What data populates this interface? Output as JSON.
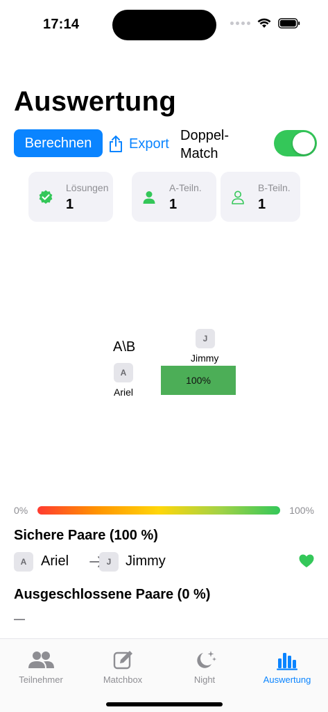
{
  "status_bar": {
    "time": "17:14"
  },
  "header": {
    "title": "Auswertung"
  },
  "toolbar": {
    "calculate_label": "Berechnen",
    "export_label": "Export",
    "double_match_line1": "Doppel-",
    "double_match_line2": "Match",
    "double_match_on": true
  },
  "stats": [
    {
      "label": "Lösungen",
      "value": "1",
      "icon": "checkmark-seal-icon"
    },
    {
      "label": "A-Teiln.",
      "value": "1",
      "icon": "person-fill-icon"
    },
    {
      "label": "B-Teiln.",
      "value": "1",
      "icon": "person-outline-icon"
    }
  ],
  "matrix": {
    "corner": "A\\B",
    "columns": [
      {
        "initial": "J",
        "name": "Jimmy"
      }
    ],
    "rows": [
      {
        "initial": "A",
        "name": "Ariel"
      }
    ],
    "cells": [
      {
        "row": 0,
        "col": 0,
        "value": "100%"
      }
    ]
  },
  "scale": {
    "min": "0%",
    "max": "100%"
  },
  "sure_pairs": {
    "title": "Sichere Paare (100 %)",
    "items": [
      {
        "a_initial": "A",
        "a_name": "Ariel",
        "b_initial": "J",
        "b_name": "Jimmy"
      }
    ]
  },
  "excluded_pairs": {
    "title": "Ausgeschlossene Paare (0 %)",
    "empty": "—"
  },
  "tabs": [
    {
      "label": "Teilnehmer",
      "icon": "people-icon",
      "active": false
    },
    {
      "label": "Matchbox",
      "icon": "edit-square-icon",
      "active": false
    },
    {
      "label": "Night",
      "icon": "moon-stars-icon",
      "active": false
    },
    {
      "label": "Auswertung",
      "icon": "bar-chart-icon",
      "active": true
    }
  ],
  "colors": {
    "accent": "#0a84ff",
    "success": "#34c759",
    "cell": "#4cae57"
  }
}
